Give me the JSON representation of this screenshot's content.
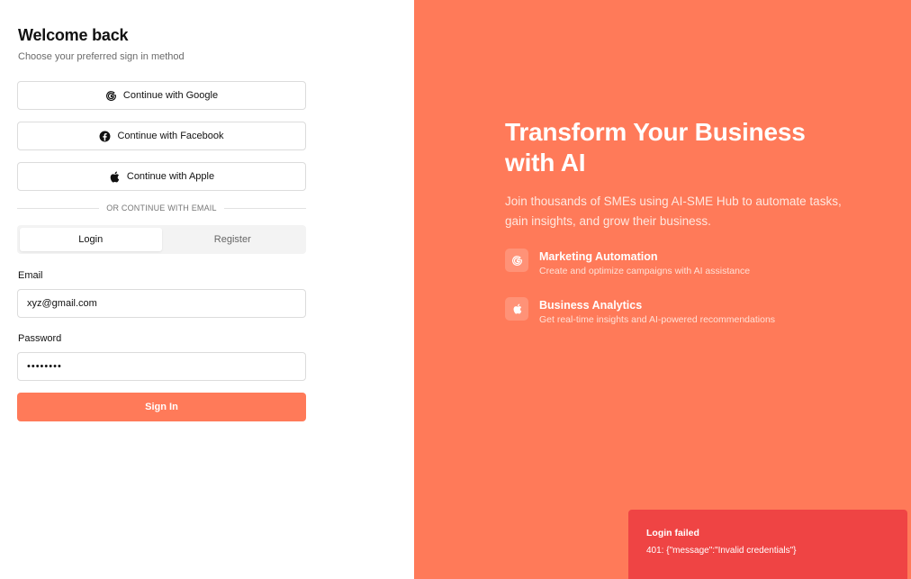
{
  "login": {
    "title": "Welcome back",
    "subtitle": "Choose your preferred sign in method",
    "social": {
      "google": "Continue with Google",
      "facebook": "Continue with Facebook",
      "apple": "Continue with Apple"
    },
    "divider": "OR CONTINUE WITH EMAIL",
    "tabs": [
      {
        "label": "Login",
        "active": true
      },
      {
        "label": "Register",
        "active": false
      }
    ],
    "email": {
      "label": "Email",
      "value": "xyz@gmail.com"
    },
    "password": {
      "label": "Password",
      "value": "••••••••"
    },
    "submit": "Sign In"
  },
  "hero": {
    "title": "Transform Your Business with AI",
    "description": "Join thousands of SMEs using AI-SME Hub to automate tasks, gain insights, and grow their business.",
    "features": [
      {
        "icon": "google-icon",
        "name": "Marketing Automation",
        "description": "Create and optimize campaigns with AI assistance"
      },
      {
        "icon": "apple-icon",
        "name": "Business Analytics",
        "description": "Get real-time insights and AI-powered recommendations"
      }
    ]
  },
  "toast": {
    "title": "Login failed",
    "message": "401: {\"message\":\"Invalid credentials\"}"
  },
  "colors": {
    "accent": "#ff7a59",
    "error": "#ef4444"
  }
}
